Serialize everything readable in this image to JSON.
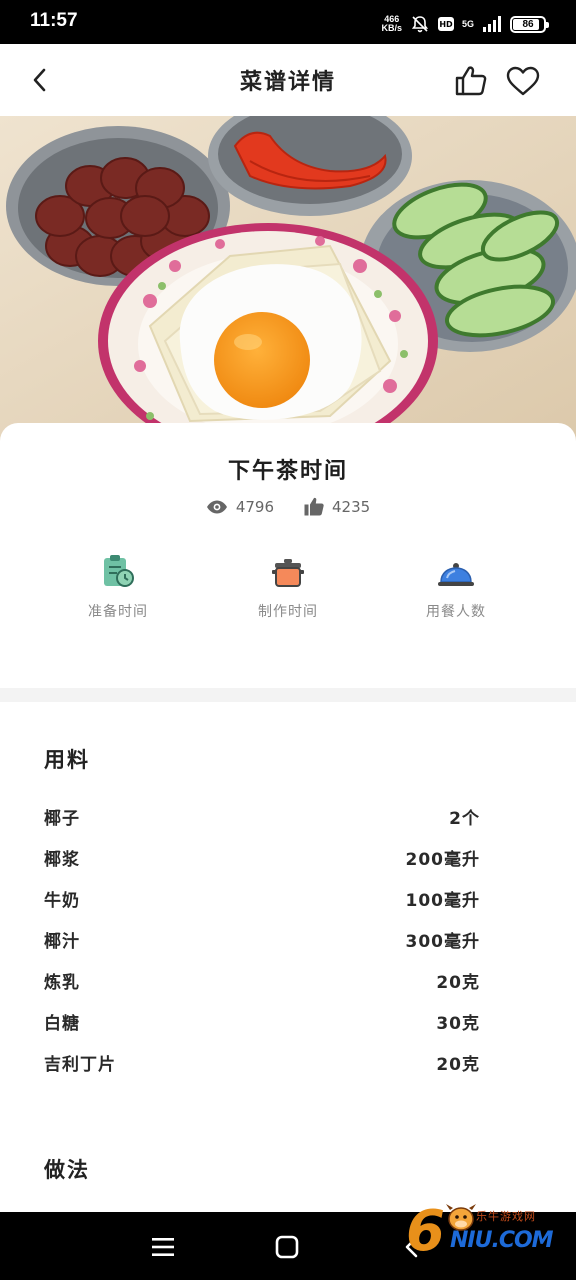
{
  "status_bar": {
    "time": "11:57",
    "net_speed_value": "466",
    "net_speed_unit": "KB/s",
    "hd_badge": "HD",
    "network": "5G",
    "battery": "86",
    "battery_level_percent": 86
  },
  "header": {
    "title": "菜谱详情",
    "back_icon": "back-arrow-icon",
    "like_icon": "thumbs-up-icon",
    "favorite_icon": "heart-icon"
  },
  "recipe": {
    "name": "下午茶时间",
    "views": "4796",
    "likes": "4235"
  },
  "info": {
    "prep_time_label": "准备时间",
    "cook_time_label": "制作时间",
    "servings_label": "用餐人数"
  },
  "ingredients": {
    "title": "用料",
    "items": [
      {
        "name": "椰子",
        "amount": "2个"
      },
      {
        "name": "椰浆",
        "amount": "200毫升"
      },
      {
        "name": "牛奶",
        "amount": "100毫升"
      },
      {
        "name": "椰汁",
        "amount": "300毫升"
      },
      {
        "name": "炼乳",
        "amount": "20克"
      },
      {
        "name": "白糖",
        "amount": "30克"
      },
      {
        "name": "吉利丁片",
        "amount": "20克"
      }
    ]
  },
  "steps": {
    "title": "做法"
  },
  "watermark": {
    "brand_small": "乐牛游戏网",
    "brand_big": "NIU.COM",
    "digit": "6"
  },
  "colors": {
    "status_bar_bg": "#000000",
    "accent_orange": "#f07a3a",
    "accent_green": "#4fae8c",
    "accent_blue": "#3d7fe0",
    "divider": "#f3f3f3"
  }
}
